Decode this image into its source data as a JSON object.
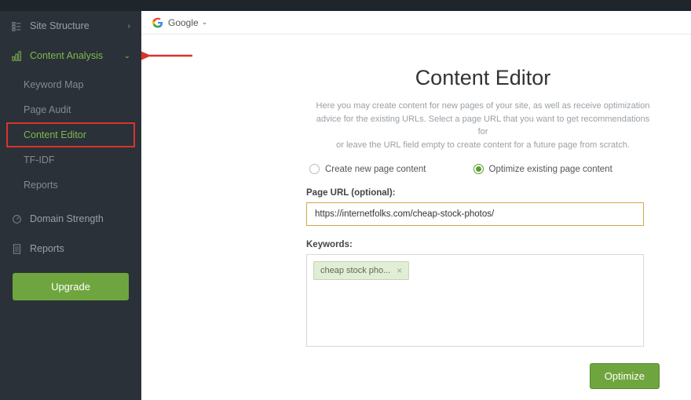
{
  "sidebar": {
    "site_structure": "Site Structure",
    "content_analysis": "Content Analysis",
    "sub_items": [
      "Keyword Map",
      "Page Audit",
      "Content Editor",
      "TF-IDF",
      "Reports"
    ],
    "domain_strength": "Domain Strength",
    "reports": "Reports",
    "upgrade": "Upgrade"
  },
  "header": {
    "engine": "Google"
  },
  "editor": {
    "title": "Content Editor",
    "desc_line1": "Here you may create content for new pages of your site, as well as receive optimization",
    "desc_line2": "advice for the existing URLs. Select a page URL that you want to get recommendations for",
    "desc_line3": "or leave the URL field empty to create content for a future page from scratch.",
    "radio_create": "Create new page content",
    "radio_optimize": "Optimize existing page content",
    "url_label": "Page URL (optional):",
    "url_value": "https://internetfolks.com/cheap-stock-photos/",
    "keywords_label": "Keywords:",
    "keyword_tag": "cheap stock pho...",
    "optimize_btn": "Optimize"
  }
}
